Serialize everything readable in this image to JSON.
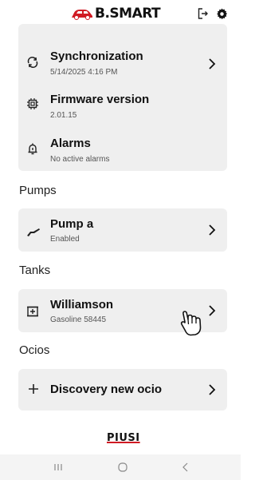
{
  "header": {
    "brand": "B.SMART",
    "logout_icon": "logout-icon",
    "settings_icon": "gear-icon"
  },
  "system": {
    "sync_title": "Synchronization",
    "sync_value": "5/14/2025 4:16 PM",
    "firmware_title": "Firmware version",
    "firmware_value": "2.01.15",
    "alarms_title": "Alarms",
    "alarms_value": "No active alarms"
  },
  "pumps": {
    "section": "Pumps",
    "items": [
      {
        "name": "Pump a",
        "status": "Enabled"
      }
    ]
  },
  "tanks": {
    "section": "Tanks",
    "items": [
      {
        "name": "Williamson",
        "detail": "Gasoline 58445"
      }
    ]
  },
  "ocios": {
    "section": "Ocios",
    "add_label": "Discovery new ocio"
  },
  "footer": {
    "brand": "PIUSI"
  },
  "colors": {
    "card": "#efefef",
    "accent": "#d01b24"
  }
}
